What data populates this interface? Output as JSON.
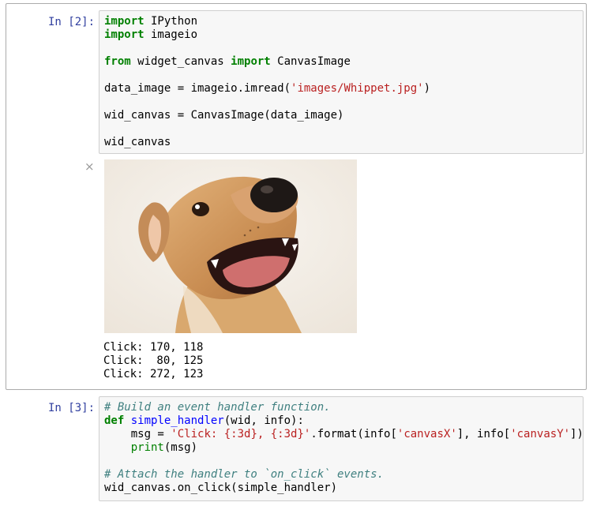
{
  "cell1": {
    "prompt": "In [2]:",
    "code_lines": [
      [
        {
          "t": "kw",
          "v": "import"
        },
        {
          "t": "",
          "v": " IPython"
        }
      ],
      [
        {
          "t": "kw",
          "v": "import"
        },
        {
          "t": "",
          "v": " imageio"
        }
      ],
      [],
      [
        {
          "t": "kw",
          "v": "from"
        },
        {
          "t": "",
          "v": " widget_canvas "
        },
        {
          "t": "kw",
          "v": "import"
        },
        {
          "t": "",
          "v": " CanvasImage"
        }
      ],
      [],
      [
        {
          "t": "",
          "v": "data_image = imageio.imread("
        },
        {
          "t": "str",
          "v": "'images/Whippet.jpg'"
        },
        {
          "t": "",
          "v": ")"
        }
      ],
      [],
      [
        {
          "t": "",
          "v": "wid_canvas = CanvasImage(data_image)"
        }
      ],
      [],
      [
        {
          "t": "",
          "v": "wid_canvas"
        }
      ]
    ],
    "close_icon": "×",
    "output_lines": [
      "Click: 170, 118",
      "Click:  80, 125",
      "Click: 272, 123"
    ]
  },
  "cell2": {
    "prompt": "In [3]:",
    "code_lines": [
      [
        {
          "t": "cmt",
          "v": "# Build an event handler function."
        }
      ],
      [
        {
          "t": "kw",
          "v": "def"
        },
        {
          "t": "",
          "v": " "
        },
        {
          "t": "fn",
          "v": "simple_handler"
        },
        {
          "t": "",
          "v": "(wid, info):"
        }
      ],
      [
        {
          "t": "",
          "v": "    msg = "
        },
        {
          "t": "str",
          "v": "'Click: {:3d}, {:3d}'"
        },
        {
          "t": "",
          "v": ".format(info["
        },
        {
          "t": "str",
          "v": "'canvasX'"
        },
        {
          "t": "",
          "v": "], info["
        },
        {
          "t": "str",
          "v": "'canvasY'"
        },
        {
          "t": "",
          "v": "])"
        }
      ],
      [
        {
          "t": "",
          "v": "    "
        },
        {
          "t": "blt",
          "v": "print"
        },
        {
          "t": "",
          "v": "(msg)"
        }
      ],
      [],
      [
        {
          "t": "cmt",
          "v": "# Attach the handler to `on_click` events."
        }
      ],
      [
        {
          "t": "",
          "v": "wid_canvas.on_click(simple_handler)"
        }
      ]
    ]
  }
}
